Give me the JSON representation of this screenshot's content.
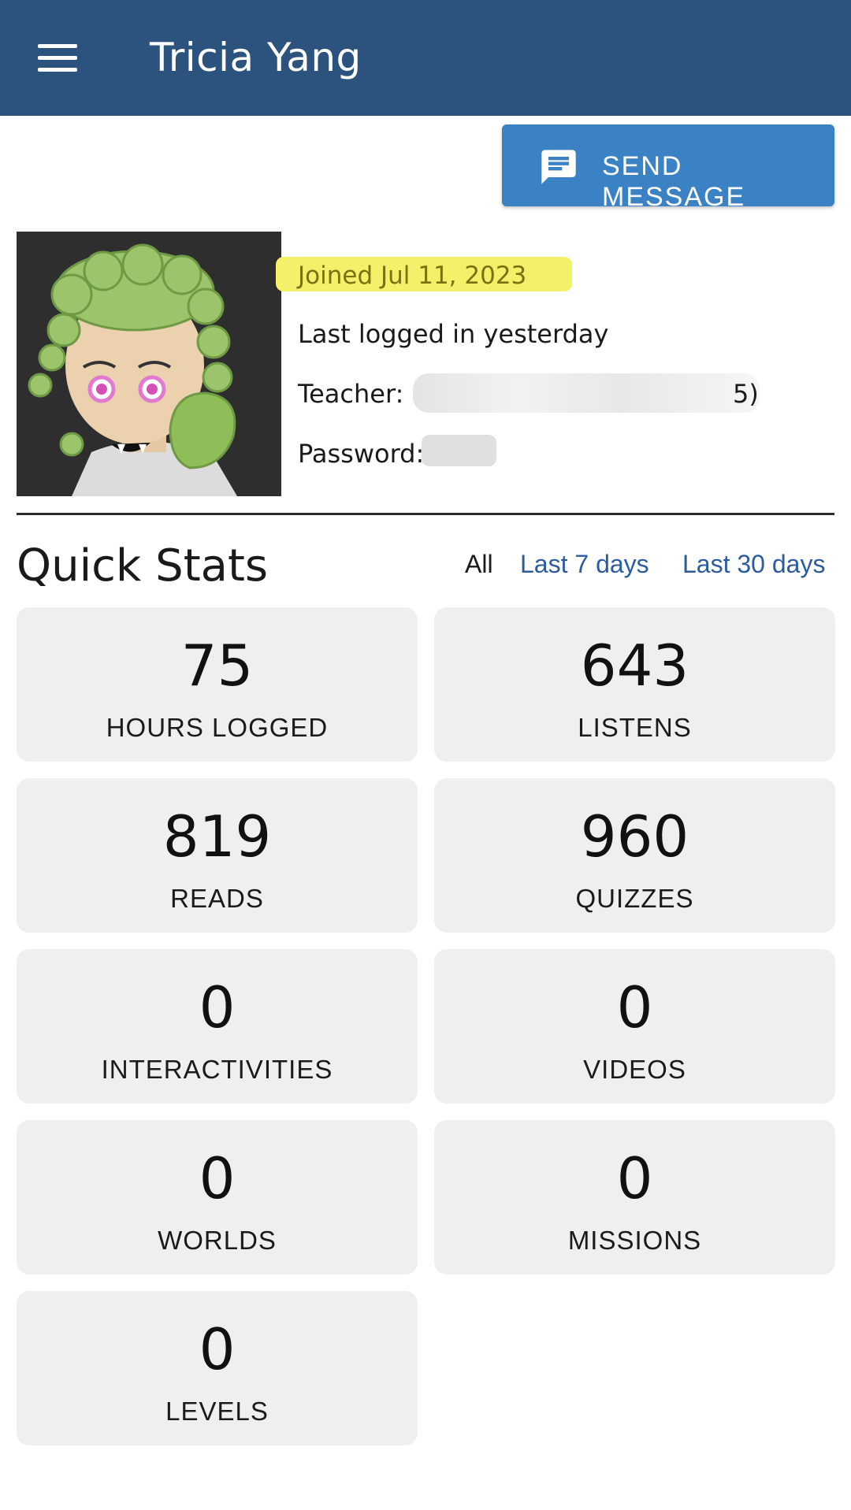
{
  "header": {
    "title": "Tricia Yang",
    "menu_icon": "hamburger-menu-icon",
    "background": "#2c527e"
  },
  "send_message": {
    "label": "SEND MESSAGE",
    "icon": "message-icon",
    "color": "#3b82c4"
  },
  "profile": {
    "joined": "Joined Jul 11, 2023",
    "last_logged": "Last logged in yesterday",
    "teacher_label": "Teacher:",
    "teacher_visible_tail": "5)",
    "password_label": "Password:"
  },
  "quick_stats": {
    "title": "Quick Stats",
    "filters": [
      "All",
      "Last 7 days",
      "Last 30 days"
    ],
    "selected_filter": "All",
    "stats": [
      {
        "value": "75",
        "label": "HOURS LOGGED"
      },
      {
        "value": "643",
        "label": "LISTENS"
      },
      {
        "value": "819",
        "label": "READS"
      },
      {
        "value": "960",
        "label": "QUIZZES"
      },
      {
        "value": "0",
        "label": "INTERACTIVITIES"
      },
      {
        "value": "0",
        "label": "VIDEOS"
      },
      {
        "value": "0",
        "label": "WORLDS"
      },
      {
        "value": "0",
        "label": "MISSIONS"
      },
      {
        "value": "0",
        "label": "LEVELS"
      }
    ]
  }
}
